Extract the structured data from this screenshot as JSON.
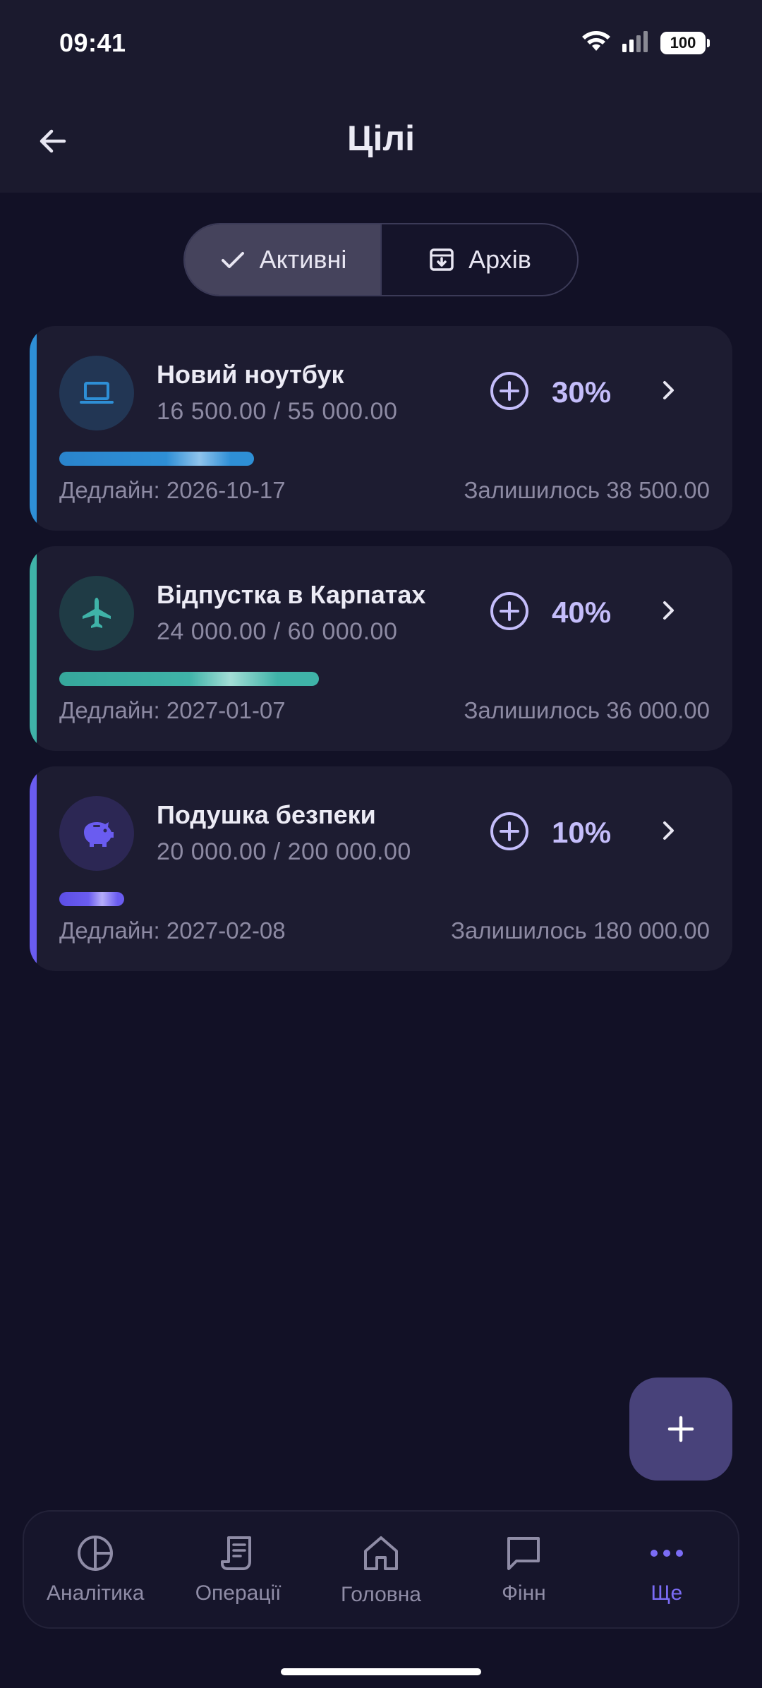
{
  "status_bar": {
    "time": "09:41",
    "battery": "100"
  },
  "header": {
    "title": "Цілі"
  },
  "tabs": [
    {
      "label": "Активні",
      "active": true
    },
    {
      "label": "Архів",
      "active": false
    }
  ],
  "goals": [
    {
      "name": "Новий ноутбук",
      "amount": "16 500.00 / 55 000.00",
      "percent": "30%",
      "progress": 0.3,
      "deadline": "Дедлайн: 2026-10-17",
      "remaining": "Залишилось 38 500.00",
      "icon": "laptop-icon",
      "color": "#2e8fd6"
    },
    {
      "name": "Відпустка в Карпатах",
      "amount": "24 000.00 / 60 000.00",
      "percent": "40%",
      "progress": 0.4,
      "deadline": "Дедлайн: 2027-01-07",
      "remaining": "Залишилось 36 000.00",
      "icon": "airplane-icon",
      "color": "#3fb3a8"
    },
    {
      "name": "Подушка безпеки",
      "amount": "20 000.00 / 200 000.00",
      "percent": "10%",
      "progress": 0.1,
      "deadline": "Дедлайн: 2027-02-08",
      "remaining": "Залишилось 180 000.00",
      "icon": "piggy-bank-icon",
      "color": "#6a5cf0"
    }
  ],
  "bottom_nav": [
    {
      "label": "Аналітика",
      "icon": "pie-chart-icon",
      "active": false
    },
    {
      "label": "Операції",
      "icon": "receipt-icon",
      "active": false
    },
    {
      "label": "Головна",
      "icon": "home-icon",
      "active": false
    },
    {
      "label": "Фінн",
      "icon": "chat-icon",
      "active": false
    },
    {
      "label": "Ще",
      "icon": "more-dots-icon",
      "active": true
    }
  ],
  "colors": {
    "accent": "#7b6cf5",
    "percent": "#c4bdfa",
    "fab": "#48427a"
  }
}
